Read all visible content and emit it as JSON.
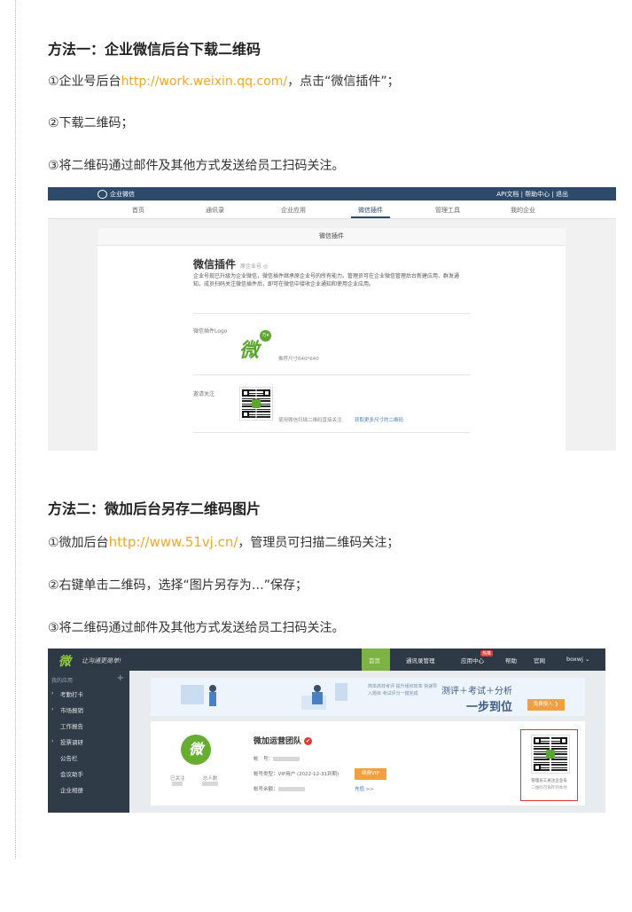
{
  "method1": {
    "heading": "方法一：企业微信后台下载二维码",
    "step1_prefix": "①企业号后台",
    "step1_link": "http://work.weixin.qq.com/",
    "step1_suffix": "，点击“微信插件”；",
    "step2": "②下载二维码；",
    "step3": "③将二维码通过邮件及其他方式发送给员工扫码关注。"
  },
  "screenshot1": {
    "app_name": "企业微信",
    "top_right": "API文档 | 帮助中心 | 退出",
    "nav": [
      "首页",
      "通讯录",
      "企业应用",
      "微信插件",
      "管理工具",
      "我的企业"
    ],
    "active_nav": "微信插件",
    "card_header": "微信插件",
    "title": "微信插件",
    "title_sub": "原企业号 ◎",
    "desc": "企业号现已升级为企业微信，微信插件继承原企业号的所有能力。管理员可在企业微信管理后台新建应用、群发通知，成员扫码关注微信插件后，即可在微信中接收企业通知和使用企业应用。",
    "logo_label": "微信插件Logo",
    "logo_glyph": "微",
    "logo_badge": "万e",
    "logo_hint": "推荐尺寸640*640",
    "follow_label": "邀请关注",
    "qr_hint": "使用微信扫描二维码直接关注",
    "qr_download": "获取更多尺寸的二维码"
  },
  "method2": {
    "heading": "方法二：微加后台另存二维码图片",
    "step1_prefix": "①微加后台",
    "step1_link": "http://www.51vj.cn/",
    "step1_suffix": "，管理员可扫描二维码关注；",
    "step2": "②右键单击二维码，选择“图片另存为…”保存；",
    "step3": "③将二维码通过邮件及其他方式发送给员工扫码关注。"
  },
  "screenshot2": {
    "logo": "微",
    "slogan": "让沟通更简单!",
    "menu": [
      "首页",
      "通讯录管理",
      "应用中心",
      "帮助",
      "官网",
      "boxwj ⌄"
    ],
    "hot_badge": "热推",
    "sidebar_header": "我的应用",
    "sidebar_plus": "+",
    "sidebar_items": [
      "考勤打卡",
      "市场报销",
      "工作报告",
      "投票调研",
      "公告栏",
      "会议助手",
      "企业相册"
    ],
    "banner_small": "简单高效考评 提升组织效率 快速导入题目 考试评分一键完成",
    "banner_line1": "测评＋考试＋分析",
    "banner_line2": "一步到位",
    "banner_button": "免费接入 ❯",
    "org_name": "微加运营团队",
    "verified_mark": "✔",
    "id_label": "帐　号：",
    "account_type": "帐号类型：VIP用户 (2022-12-31到期)",
    "vip_button": "续费VIP",
    "account_balance": "帐号余额：",
    "recharge": "充值 >>",
    "stat_followed": "已关注",
    "stat_total": "总人数",
    "qr_caption1": "管理员工关注企业号",
    "qr_caption2": "二维码可保存到本地"
  }
}
